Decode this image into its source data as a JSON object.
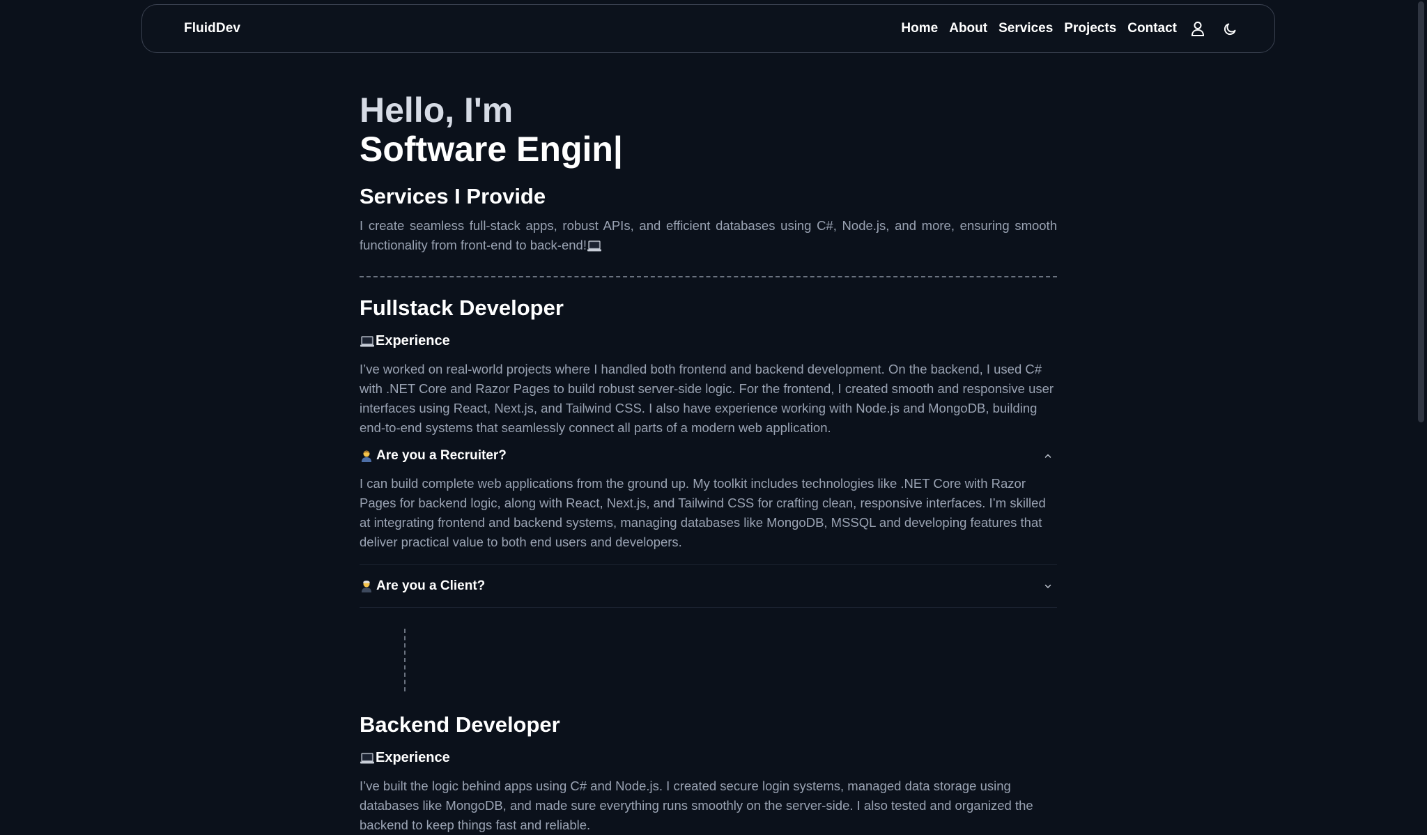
{
  "nav": {
    "brand": "FluidDev",
    "links": [
      "Home",
      "About",
      "Services",
      "Projects",
      "Contact"
    ],
    "icons": [
      "user-icon",
      "moon-icon"
    ]
  },
  "hero": {
    "line1": "Hello, I'm",
    "line2": "Software Engin|"
  },
  "services": {
    "title": "Services I Provide",
    "description": "I create seamless full-stack apps, robust APIs, and efficient databases using C#, Node.js, and more, ensuring smooth functionality from front-end to back-end!"
  },
  "fullstack": {
    "title": "Fullstack Developer",
    "experience_label": "Experience",
    "experience_text": "I’ve worked on real-world projects where I handled both frontend and backend development. On the backend, I used C# with .NET Core and Razor Pages to build robust server-side logic. For the frontend, I created smooth and responsive user interfaces using React, Next.js, and Tailwind CSS. I also have experience working with Node.js and MongoDB, building end-to-end systems that seamlessly connect all parts of a modern web application.",
    "recruiter_question": "Are you a Recruiter?",
    "recruiter_answer": "I can build complete web applications from the ground up. My toolkit includes technologies like .NET Core with Razor Pages for backend logic, along with React, Next.js, and Tailwind CSS for crafting clean, responsive interfaces. I’m skilled at integrating frontend and backend systems, managing databases like MongoDB, MSSQL and developing features that deliver practical value to both end users and developers.",
    "client_question": "Are you a Client?"
  },
  "backend": {
    "title": "Backend Developer",
    "experience_label": "Experience",
    "experience_text": "I’ve built the logic behind apps using C# and Node.js. I created secure login systems, managed data storage using databases like MongoDB, and made sure everything runs smoothly on the server-side. I also tested and organized the backend to keep things fast and reliable."
  },
  "colors": {
    "background": "#0b111b",
    "text_primary": "#ffffff",
    "text_muted": "#9aa3b3",
    "border": "#3a4150"
  }
}
